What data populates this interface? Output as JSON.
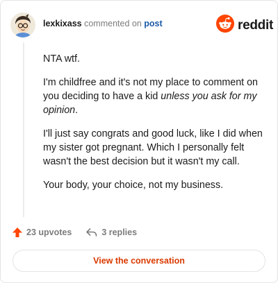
{
  "comment": {
    "username": "lexkixass",
    "action_text": "commented on",
    "target_link": "post",
    "avatar_icon": "user-avatar-icon"
  },
  "brand": {
    "name": "reddit",
    "icon": "reddit-logo-icon",
    "color": "#ff4500"
  },
  "body": {
    "p1": "NTA wtf.",
    "p2_start": "I'm childfree and it's not my place to comment on you deciding to have a kid ",
    "p2_emphasis": "unless you ask for my opinion",
    "p2_end": ".",
    "p3": "I'll just say congrats and good luck, like I did when my sister got pregnant. Which I personally felt wasn't the best decision but it wasn't my call.",
    "p4": "Your body, your choice, not my business."
  },
  "actions": {
    "upvotes_label": "23 upvotes",
    "upvote_icon": "upvote-arrow-icon",
    "replies_label": "3 replies",
    "reply_icon": "reply-arrow-icon"
  },
  "footer": {
    "view_label": "View the conversation"
  },
  "colors": {
    "accent": "#d93a00",
    "link": "#1c5aa6",
    "muted": "#7c7c7c"
  }
}
